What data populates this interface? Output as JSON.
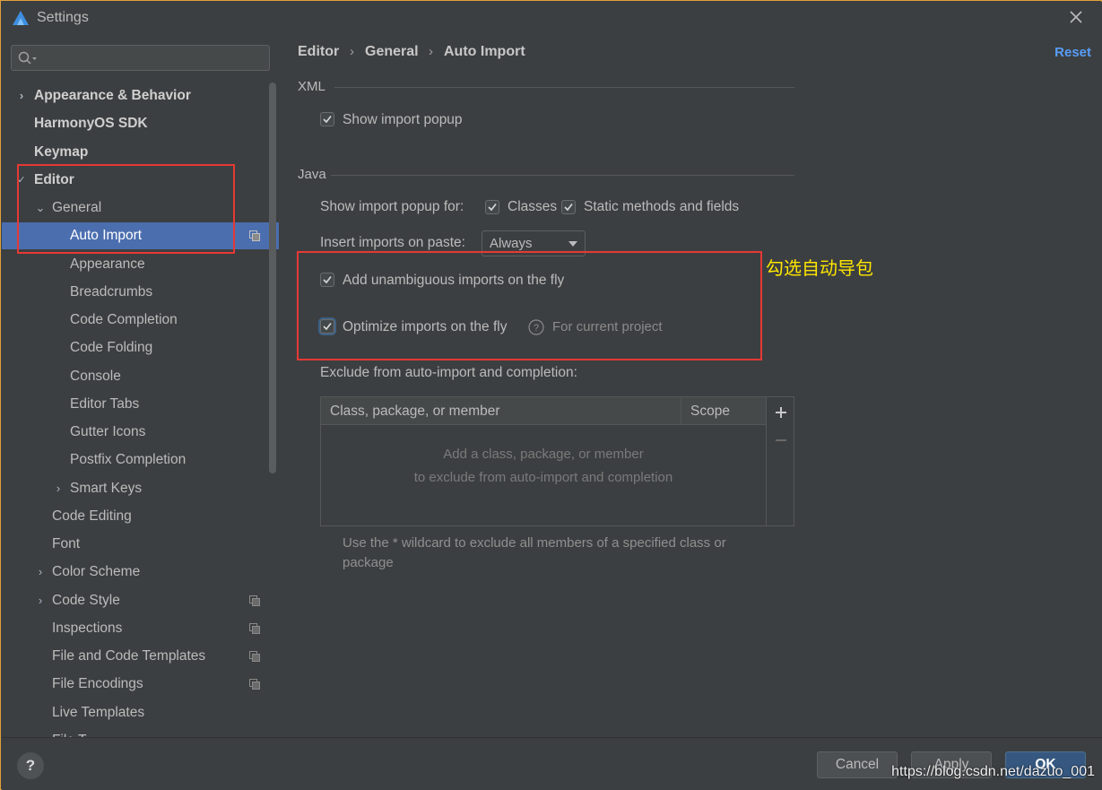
{
  "window": {
    "title": "Settings"
  },
  "sidebar": {
    "search_placeholder": "",
    "items": [
      {
        "label": "Appearance & Behavior"
      },
      {
        "label": "HarmonyOS SDK"
      },
      {
        "label": "Keymap"
      },
      {
        "label": "Editor"
      },
      {
        "label": "General"
      },
      {
        "label": "Auto Import"
      },
      {
        "label": "Appearance"
      },
      {
        "label": "Breadcrumbs"
      },
      {
        "label": "Code Completion"
      },
      {
        "label": "Code Folding"
      },
      {
        "label": "Console"
      },
      {
        "label": "Editor Tabs"
      },
      {
        "label": "Gutter Icons"
      },
      {
        "label": "Postfix Completion"
      },
      {
        "label": "Smart Keys"
      },
      {
        "label": "Code Editing"
      },
      {
        "label": "Font"
      },
      {
        "label": "Color Scheme"
      },
      {
        "label": "Code Style"
      },
      {
        "label": "Inspections"
      },
      {
        "label": "File and Code Templates"
      },
      {
        "label": "File Encodings"
      },
      {
        "label": "Live Templates"
      },
      {
        "label": "File T..."
      }
    ]
  },
  "breadcrumb": {
    "items": [
      "Editor",
      "General",
      "Auto Import"
    ]
  },
  "reset_label": "Reset",
  "xml": {
    "section_title": "XML",
    "show_import_popup": {
      "label": "Show import popup",
      "checked": true
    }
  },
  "java": {
    "section_title": "Java",
    "show_popup_for_label": "Show import popup for:",
    "classes": {
      "label": "Classes",
      "checked": true
    },
    "static_methods": {
      "label": "Static methods and fields",
      "checked": true
    },
    "insert_on_paste_label": "Insert imports on paste:",
    "insert_on_paste_value": "Always",
    "add_unambiguous": {
      "label": "Add unambiguous imports on the fly",
      "checked": true
    },
    "optimize_imports": {
      "label": "Optimize imports on the fly",
      "checked": true,
      "hint": "For current project"
    },
    "exclude_label": "Exclude from auto-import and completion:",
    "table": {
      "columns": [
        "Class, package, or member",
        "Scope"
      ],
      "empty_line1": "Add a class, package, or member",
      "empty_line2": "to exclude from auto-import and completion"
    },
    "wildcard_note_line1": "Use the * wildcard to exclude all members of a specified class or",
    "wildcard_note_line2": "package"
  },
  "annotation": "勾选自动导包",
  "buttons": {
    "cancel": "Cancel",
    "apply": "Apply",
    "ok": "OK",
    "help": "?"
  },
  "watermark": "https://blog.csdn.net/dazuo_001",
  "colors": {
    "accent": "#4b6eaf",
    "link": "#589df6",
    "annotation_box": "#e53935",
    "annotation_text": "#ffe600"
  }
}
